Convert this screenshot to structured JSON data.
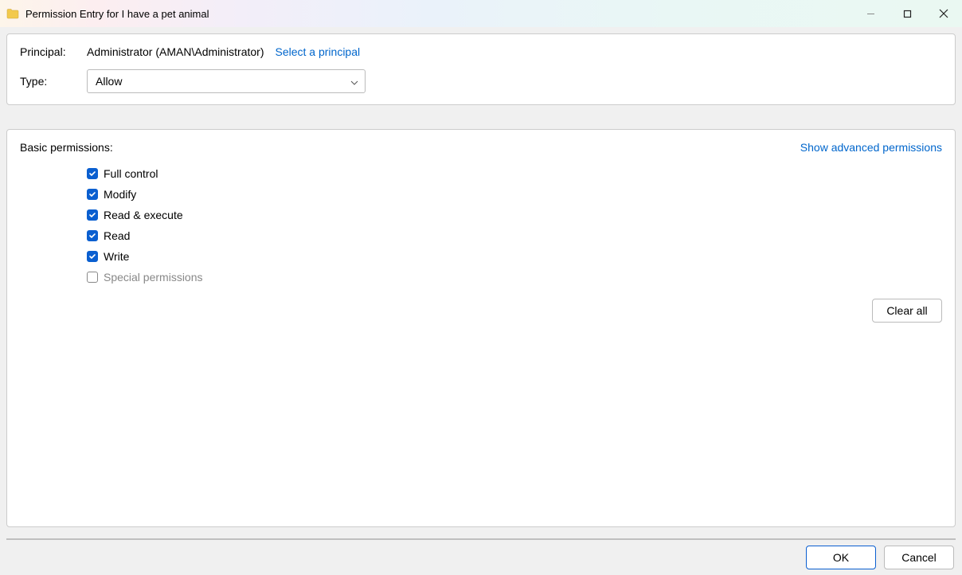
{
  "window": {
    "title": "Permission Entry for I have a pet animal"
  },
  "top_panel": {
    "principal_label": "Principal:",
    "principal_value": "Administrator (AMAN\\Administrator)",
    "select_principal_link": "Select a principal",
    "type_label": "Type:",
    "type_value": "Allow"
  },
  "perm_panel": {
    "title": "Basic permissions:",
    "advanced_link": "Show advanced permissions",
    "items": [
      {
        "label": "Full control",
        "checked": true,
        "disabled": false
      },
      {
        "label": "Modify",
        "checked": true,
        "disabled": false
      },
      {
        "label": "Read & execute",
        "checked": true,
        "disabled": false
      },
      {
        "label": "Read",
        "checked": true,
        "disabled": false
      },
      {
        "label": "Write",
        "checked": true,
        "disabled": false
      },
      {
        "label": "Special permissions",
        "checked": false,
        "disabled": true
      }
    ],
    "clear_all_label": "Clear all"
  },
  "footer": {
    "ok_label": "OK",
    "cancel_label": "Cancel"
  }
}
